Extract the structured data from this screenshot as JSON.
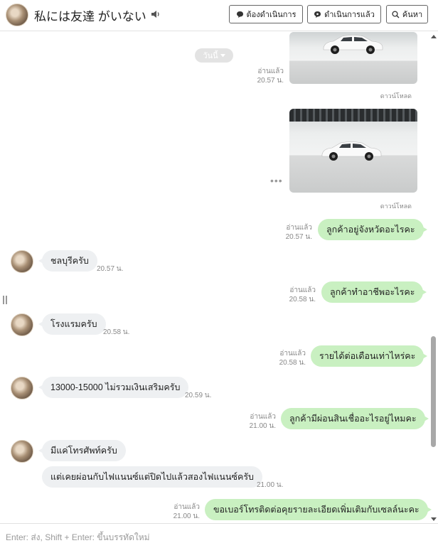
{
  "header": {
    "chat_name": "私には友達 がいない",
    "btn_todo": "ต้องดำเนินการ",
    "btn_done": "ดำเนินการแล้ว",
    "btn_search": "ค้นหา"
  },
  "chat": {
    "date_pill": "วันนี้",
    "messages": [
      {
        "type": "image",
        "dir": "out",
        "read": "อ่านแล้ว",
        "time": "20.57 น.",
        "download": "ดาวน์โหลด"
      },
      {
        "type": "image",
        "dir": "out",
        "download": "ดาวน์โหลด"
      },
      {
        "type": "text",
        "dir": "out",
        "read": "อ่านแล้ว",
        "time": "20.57 น.",
        "text": "ลูกค้าอยู่จังหวัดอะไรคะ"
      },
      {
        "type": "text",
        "dir": "in",
        "time": "20.57 น.",
        "text": "ชลบุรีครับ"
      },
      {
        "type": "text",
        "dir": "out",
        "read": "อ่านแล้ว",
        "time": "20.58 น.",
        "text": "ลูกค้าทำอาชีพอะไรคะ"
      },
      {
        "type": "text",
        "dir": "in",
        "time": "20.58 น.",
        "text": "โรงแรมครับ"
      },
      {
        "type": "text",
        "dir": "out",
        "read": "อ่านแล้ว",
        "time": "20.58 น.",
        "text": "รายได้ต่อเดือนเท่าไหร่คะ"
      },
      {
        "type": "text",
        "dir": "in",
        "time": "20.59 น.",
        "text": "13000-15000 ไม่รวมเงินเสริมครับ"
      },
      {
        "type": "text",
        "dir": "out",
        "read": "อ่านแล้ว",
        "time": "21.00 น.",
        "text": "ลูกค้ามีผ่อนสินเชื่ออะไรอยู่ไหมคะ"
      },
      {
        "type": "text",
        "dir": "in",
        "text": "มีแค่โทรศัพท์ครับ"
      },
      {
        "type": "text",
        "dir": "in",
        "time": "21.00 น.",
        "text": "แต่เคยผ่อนกับไฟแนนซ์แต่ปิดไปแล้วสองไฟแนนซ์ครับ"
      },
      {
        "type": "text",
        "dir": "out",
        "read": "อ่านแล้ว",
        "time": "21.00 น.",
        "text": "ขอเบอร์โทรติดต่อคุยรายละเอียดเพิ่มเติมกับเซลล์นะคะ"
      }
    ]
  },
  "input": {
    "placeholder": "Enter: ส่ง, Shift + Enter: ขึ้นบรรทัดใหม่"
  },
  "icons": {
    "header_speaker": "speaker-icon",
    "btn_todo": "chat-bubble-icon",
    "btn_done": "chat-bubble-outline-icon",
    "btn_search": "search-icon",
    "date_pill": "caret-down-icon",
    "image_more": "more-dots-icon"
  },
  "colors": {
    "outgoing_bubble": "#c9f0c1",
    "incoming_bubble": "#eef0f2",
    "meta_text": "#888888"
  }
}
